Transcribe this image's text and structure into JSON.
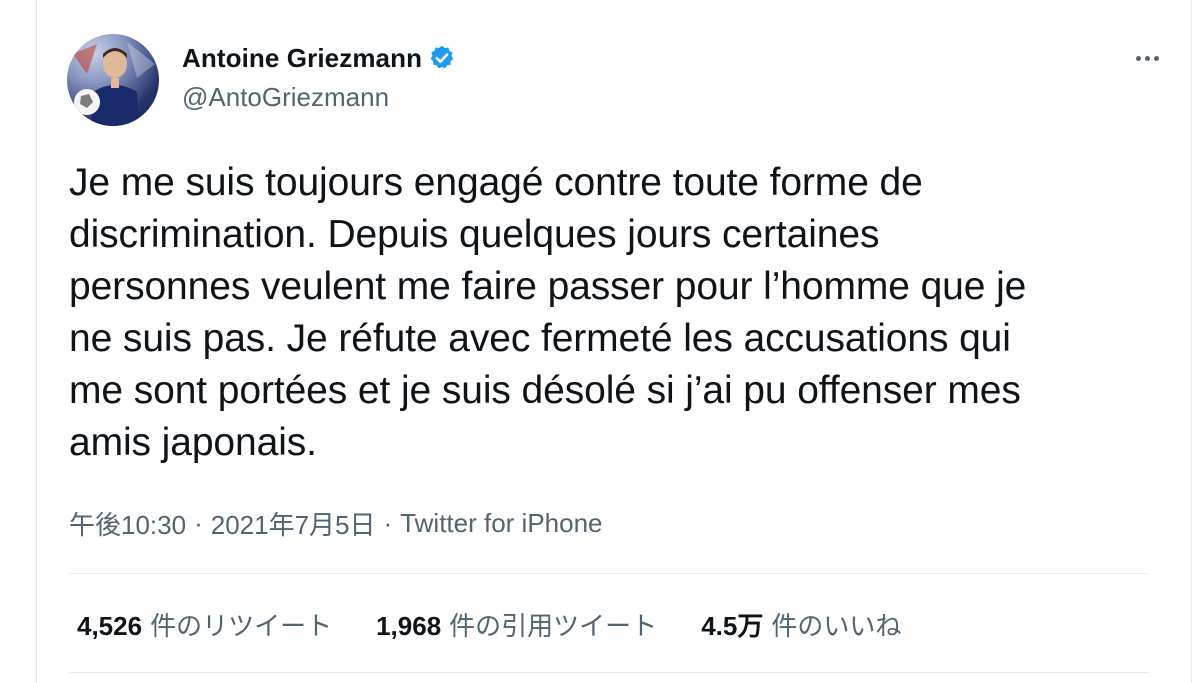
{
  "user": {
    "display_name": "Antoine Griezmann",
    "handle": "@AntoGriezmann",
    "verified": true,
    "avatar_icon": "avatar-photo",
    "verified_icon": "verified-badge-icon",
    "verified_color": "#1d9bf0"
  },
  "tweet": {
    "text": "Je me suis toujours engagé contre toute forme de\ndiscrimination. Depuis quelques jours certaines\npersonnes veulent me faire passer pour l’homme que je\nne suis pas. Je réfute avec fermeté les accusations qui\nme sont portées et je suis désolé si j’ai pu offenser mes\namis japonais."
  },
  "meta": {
    "time": "午後10:30",
    "separator": "·",
    "date": "2021年7月5日",
    "source": "Twitter for iPhone"
  },
  "stats": {
    "retweets": {
      "count": "4,526",
      "label": "件のリツイート"
    },
    "quotes": {
      "count": "1,968",
      "label": "件の引用ツイート"
    },
    "likes": {
      "count": "4.5万",
      "label": "件のいいね"
    }
  },
  "colors": {
    "text_primary": "#0f1419",
    "text_secondary": "#536471",
    "divider": "#e6ecf0"
  }
}
